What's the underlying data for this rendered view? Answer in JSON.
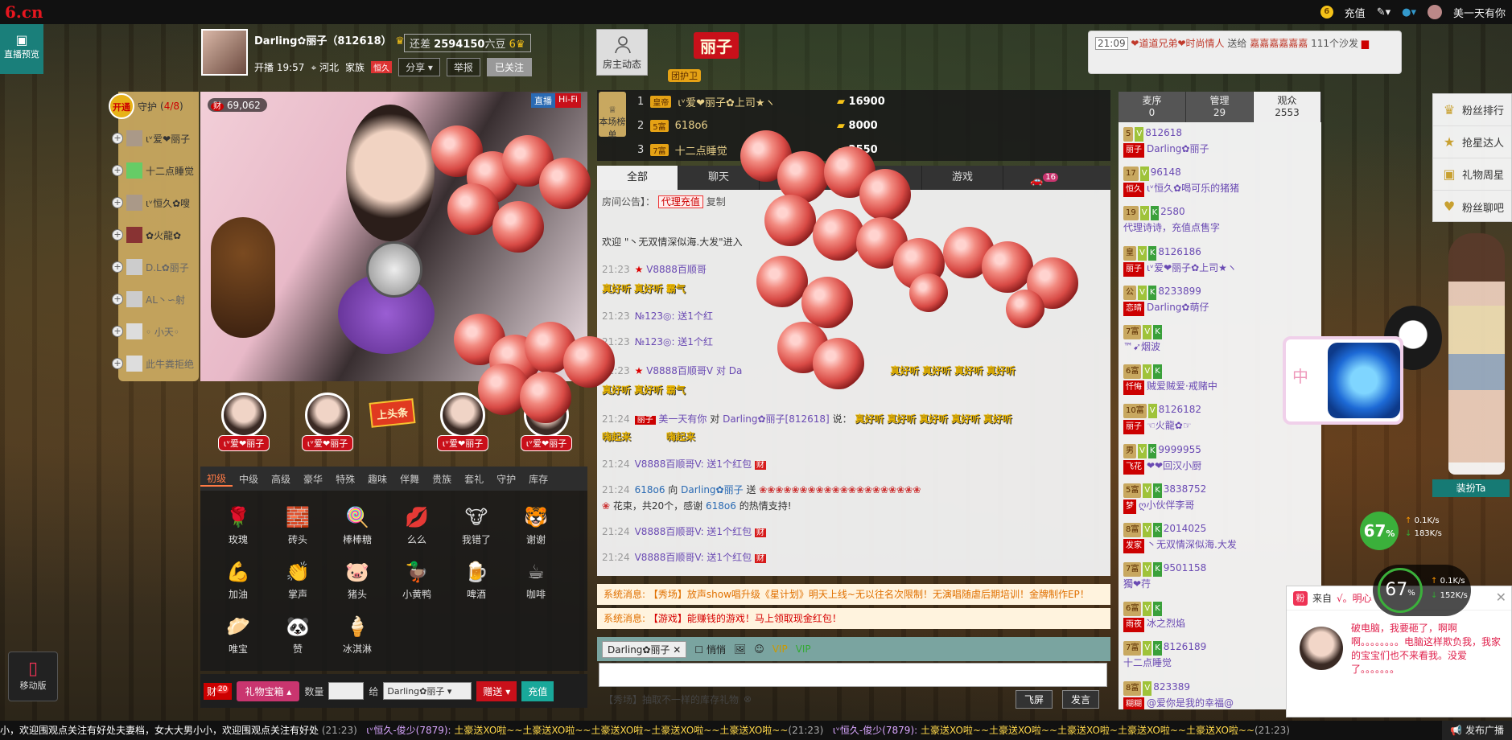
{
  "topbar": {
    "logo": "6.cn",
    "recharge": "充值",
    "username": "美一天有你"
  },
  "sidebar_preview": "直播预览",
  "host": {
    "name": "Darling✿丽子（812618）",
    "beans_label": "还差",
    "beans_value": "2594150",
    "beans_unit": "六豆",
    "level_next": "6",
    "start_label": "开播",
    "start_time": "19:57",
    "location": "河北",
    "family_label": "家族",
    "family_tag": "恒久",
    "share": "分享",
    "report": "举报",
    "followed": "已关注",
    "owner_dynamic": "房主动态",
    "display_name": "丽子",
    "guard_tag": "团护卫"
  },
  "top_notice": {
    "time": "21:09",
    "sender": "❤道道兄弟❤时尚情人",
    "verb": "送给",
    "receiver": "嘉嘉嘉嘉嘉嘉",
    "count": "111个沙发"
  },
  "guard": {
    "open": "开通",
    "title": "守护",
    "count": "4/8",
    "items": [
      "ιᵛ爱❤丽子",
      "十二点睡觉",
      "ιᵛ恒久✿嗖",
      "✿火龍✿",
      "D.L✿丽子",
      "AL丶∽射",
      "◦ 小天◦",
      "此牛粪拒绝"
    ]
  },
  "video": {
    "wealth": "69,062",
    "live": "直播",
    "hifi": "Hi-Fi"
  },
  "performers": [
    "ιᵛ爱❤丽子",
    "ιᵛ爱❤丽子",
    "ιᵛ爱❤丽子",
    "ιᵛ爱❤丽子"
  ],
  "headline": "上头条",
  "gift_tabs": [
    "初级",
    "中级",
    "高级",
    "豪华",
    "特殊",
    "趣味",
    "伴舞",
    "贵族",
    "套礼",
    "守护",
    "库存"
  ],
  "gifts": [
    {
      "icon": "🌹",
      "label": "玫瑰"
    },
    {
      "icon": "🧱",
      "label": "砖头"
    },
    {
      "icon": "🍭",
      "label": "棒棒糖"
    },
    {
      "icon": "💋",
      "label": "么么"
    },
    {
      "icon": "🐮",
      "label": "我错了"
    },
    {
      "icon": "🐯",
      "label": "谢谢"
    },
    {
      "icon": "💪",
      "label": "加油"
    },
    {
      "icon": "👏",
      "label": "掌声"
    },
    {
      "icon": "🐷",
      "label": "猪头"
    },
    {
      "icon": "🦆",
      "label": "小黄鸭"
    },
    {
      "icon": "🍺",
      "label": "啤酒"
    },
    {
      "icon": "☕",
      "label": "咖啡"
    },
    {
      "icon": "🥟",
      "label": "唯宝"
    },
    {
      "icon": "🐼",
      "label": "赞"
    },
    {
      "icon": "🍦",
      "label": "冰淇淋"
    }
  ],
  "gift_bar": {
    "wealth_count": "20",
    "wealth_label": "财",
    "bag": "礼物宝箱",
    "qty_label": "数量",
    "to_label": "给",
    "to_value": "Darling✿丽子",
    "give": "赠送",
    "recharge": "充值"
  },
  "mobile": "移动版",
  "ranking": {
    "label": "本场榜单",
    "rows": [
      {
        "rank": "1",
        "level": "皇帝",
        "name": "ιᵛ爱❤丽子✿上司★ヽ",
        "amount": "16900"
      },
      {
        "rank": "2",
        "level": "5富",
        "name": "618o6",
        "amount": "8000"
      },
      {
        "rank": "3",
        "level": "7富",
        "name": "十二点睡觉",
        "amount": "2550"
      }
    ]
  },
  "chat_tabs": [
    "全部",
    "聊天",
    "",
    "",
    "游戏",
    ""
  ],
  "car_count": "16",
  "announcement": {
    "label": "房间公告】：",
    "agent": "代理充值",
    "extra": "复制"
  },
  "messages": {
    "welcome": "欢迎 \"丶无双情深似海.大发\"进入",
    "m1_time": "21:23",
    "m1_user": "V8888百顺哥",
    "cheer": "真好听",
    "cheer2": "霸气",
    "m2_time": "21:23",
    "m2_text": "№123◎: 送1个红",
    "m3_time": "21:23",
    "m3_text": "№123◎: 送1个红",
    "m4_time": "21:23",
    "m4_text": "V8888百顺哥V 对 Da",
    "m5_time": "21:24",
    "m5_user": "美一天有你",
    "m5_to": "Darling✿丽子[812618]",
    "m5_say": "说：",
    "wake": "嗨起来",
    "m6_time": "21:24",
    "m6_text": "V8888百顺哥V: 送1个红包",
    "m7_time": "21:24",
    "m7_user": "618o6",
    "m7_to": "Darling✿丽子",
    "m7_verb": "送",
    "m7_text": "花束，共20个，感谢",
    "m7_thanks": "的热情支持!",
    "m8_time": "21:24",
    "m8_text": "V8888百顺哥V: 送1个红包",
    "m9_time": "21:24",
    "m9_text": "V8888百顺哥V: 送1个红包",
    "redbag": "财"
  },
  "system_msgs": [
    {
      "label": "系统消息:",
      "text": "【秀场】放声show唱升级《星计划》明天上线~无以往名次限制！无演唱随虐后期培训！金牌制作EP！"
    },
    {
      "label": "系统消息:",
      "text": "【游戏】能赚钱的游戏！马上领取现金红包！"
    }
  ],
  "chat_tools": {
    "target": "Darling✿丽子",
    "whisper": "悄悄"
  },
  "chat_bottom": {
    "tip": "【秀场】抽取不一样的库存礼物",
    "fly": "飞屏",
    "send": "发言"
  },
  "user_tabs": [
    {
      "label": "麦序",
      "count": "0"
    },
    {
      "label": "管理",
      "count": "29"
    },
    {
      "label": "观众",
      "count": "2553"
    }
  ],
  "users": [
    {
      "lv": "5",
      "id": "812618",
      "fam": "丽子",
      "name": "Darling✿丽子"
    },
    {
      "lv": "17",
      "id": "96148",
      "fam": "恒久",
      "name": "ιᵛ恒久✿喝可乐的猪猪"
    },
    {
      "lv": "19",
      "id": "2580",
      "fam": "",
      "name": "代理诗诗，充值点售字"
    },
    {
      "lv": "皇",
      "id": "8126186",
      "fam": "丽子",
      "name": "ιᵛ爱❤丽子✿上司★ヽ"
    },
    {
      "lv": "公",
      "id": "8233899",
      "fam": "恋晴",
      "name": "Darling✿萌仔"
    },
    {
      "lv": "7富",
      "id": "",
      "fam": "",
      "name": "™➹烟波"
    },
    {
      "lv": "6富",
      "id": "",
      "fam": "忏悔",
      "name": "贼爱贼爱·戒赌中"
    },
    {
      "lv": "10富",
      "id": "8126182",
      "fam": "丽子",
      "name": "☜火龍✿☞"
    },
    {
      "lv": "男",
      "id": "9999955",
      "fam": "飞花",
      "name": "❤❤回汉小厨"
    },
    {
      "lv": "5富",
      "id": "3838752",
      "fam": "梦",
      "name": "ღ小伙伴李哥"
    },
    {
      "lv": "8富",
      "id": "2014025",
      "fam": "发家",
      "name": "丶无双情深似海.大发"
    },
    {
      "lv": "7富",
      "id": "9501158",
      "fam": "",
      "name": "獨❤荇"
    },
    {
      "lv": "6富",
      "id": "",
      "fam": "",
      "name": "冰之烈焰"
    },
    {
      "lv": "7富",
      "id": "8126189",
      "fam": "",
      "name": "十二点睡觉"
    },
    {
      "lv": "8富",
      "id": "823389",
      "fam": "糊糊",
      "name": "@爱你是我的幸福@"
    }
  ],
  "right_menu": [
    "粉丝排行",
    "抢星达人",
    "礼物周星",
    "粉丝聊吧"
  ],
  "dress_up": "装扮Ta",
  "speed": {
    "percent": "67",
    "unit": "%",
    "up": "0.1K/s",
    "down": "183K/s",
    "up2": "0.1K/s",
    "down2": "152K/s"
  },
  "popup": {
    "from": "来自",
    "sender": "√。明心",
    "icon": "粉",
    "text": "破电脑，我要砸了，啊啊啊。。。。。。。。电脑这样欺负我，我家的宝宝们也不来看我。没爱了。。。。。。。"
  },
  "marquee": {
    "t1": "小，欢迎围观点关注有好处夫妻档，女大大男小小，欢迎围观点关注有好处",
    "t1_time": "(21:23)",
    "u2": "ιᵛ恒久-俊少(7879):",
    "t2": "土豪送XO啦~~土豪送XO啦~~土豪送XO啦",
    "t2b": "~土豪送XO啦~~土豪送XO啦~~",
    "t2_time": "(21:23)",
    "u3": "ιᵛ恒久-俊少(7879):",
    "t3": "土豪送XO啦~~土豪送XO啦~~土豪送XO啦",
    "t3b": "~土豪送XO啦~~土豪送XO啦~~",
    "t3_time": "(21:23)"
  },
  "broadcast": "发布广播"
}
